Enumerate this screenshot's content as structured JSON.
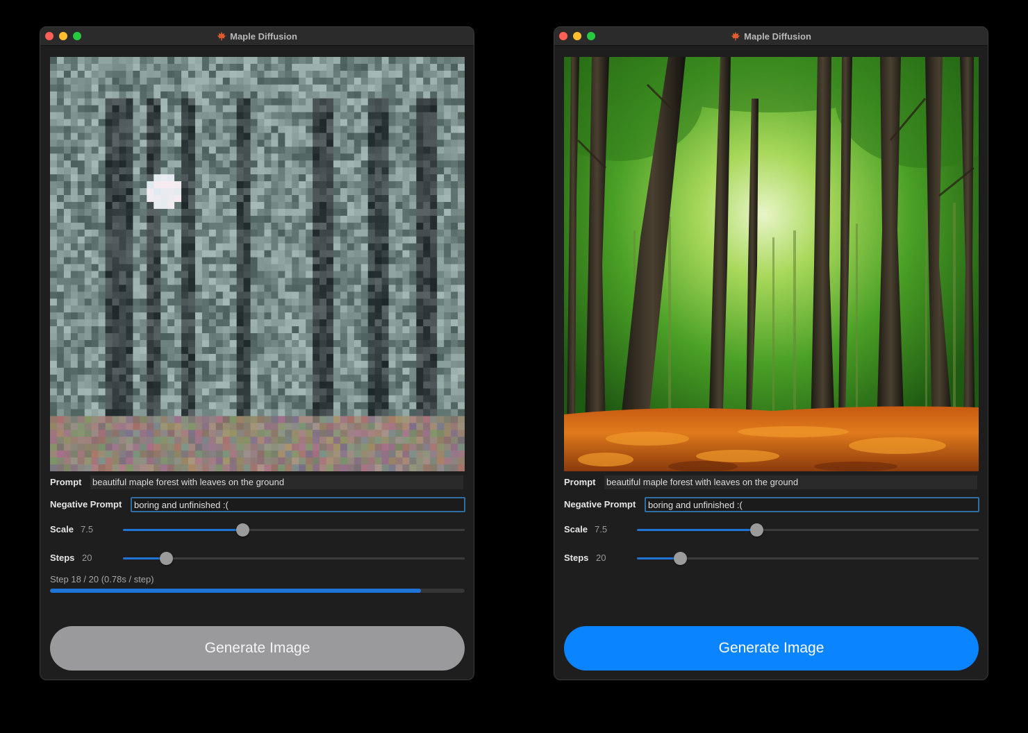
{
  "windows": [
    {
      "id": "left",
      "title": "Maple Diffusion",
      "prompt_label": "Prompt",
      "prompt_value": "beautiful maple forest with leaves on the ground",
      "negative_prompt_label": "Negative Prompt",
      "negative_prompt_value": "boring and unfinished :(",
      "scale_label": "Scale",
      "scale_value": "7.5",
      "scale_fraction": 0.35,
      "steps_label": "Steps",
      "steps_value": "20",
      "steps_fraction": 0.125,
      "progress_text": "Step 18 / 20 (0.78s / step)",
      "progress_fraction": 0.895,
      "generate_label": "Generate Image",
      "generate_enabled": false,
      "image_state": "noisy preview of forest"
    },
    {
      "id": "right",
      "title": "Maple Diffusion",
      "prompt_label": "Prompt",
      "prompt_value": "beautiful maple forest with leaves on the ground",
      "negative_prompt_label": "Negative Prompt",
      "negative_prompt_value": "boring and unfinished :(",
      "scale_label": "Scale",
      "scale_value": "7.5",
      "scale_fraction": 0.35,
      "steps_label": "Steps",
      "steps_value": "20",
      "steps_fraction": 0.125,
      "generate_label": "Generate Image",
      "generate_enabled": true,
      "image_state": "finished forest image with orange leaves"
    }
  ],
  "colors": {
    "accent": "#0a84ff",
    "slider_fill": "#1f74d8",
    "disabled_button": "#9a9a9d",
    "window_bg": "#1e1e1e",
    "focus_ring": "#2f6fa6"
  },
  "icons": {
    "title_icon": "maple-leaf-icon",
    "window_controls": [
      "close-icon",
      "minimize-icon",
      "zoom-icon"
    ]
  }
}
